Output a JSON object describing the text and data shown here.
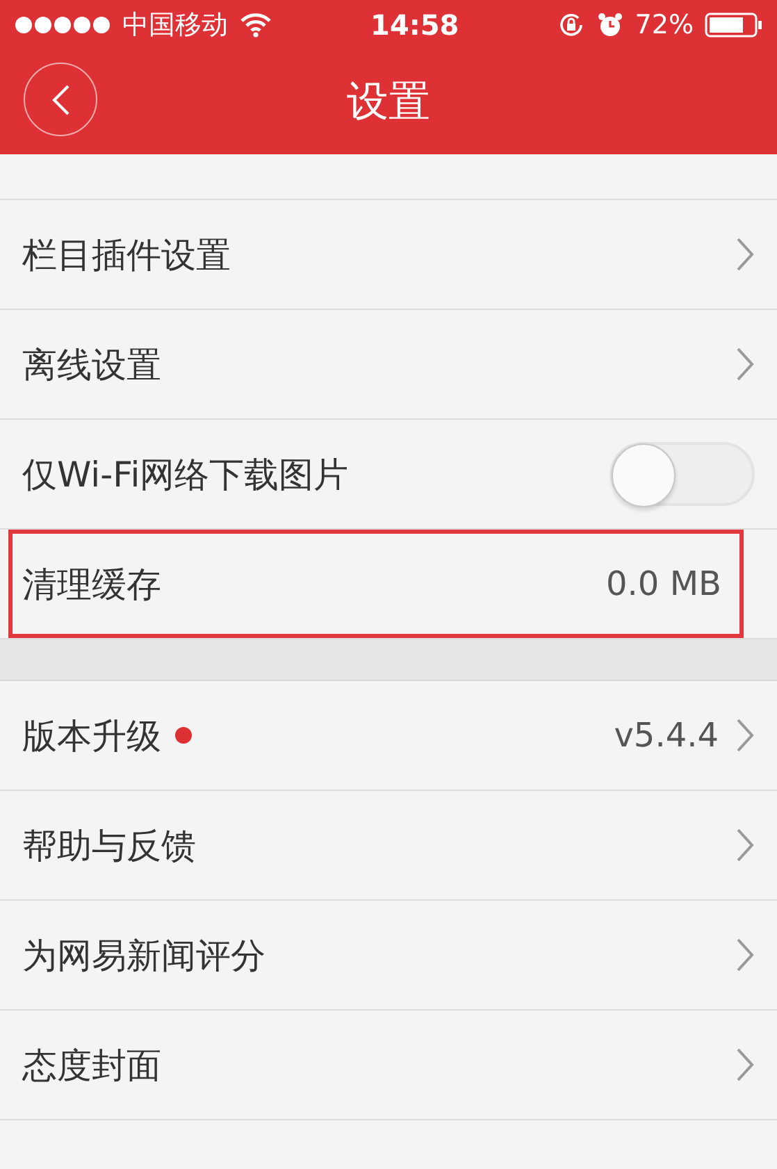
{
  "status_bar": {
    "carrier": "中国移动",
    "time": "14:58",
    "battery": "72%"
  },
  "header": {
    "title": "设置"
  },
  "groups": [
    {
      "rows": [
        {
          "kind": "link",
          "label": "栏目插件设置"
        },
        {
          "kind": "link",
          "label": "离线设置"
        },
        {
          "kind": "toggle",
          "label": "仅Wi-Fi网络下载图片",
          "on": false
        },
        {
          "kind": "value",
          "label": "清理缓存",
          "value": "0.0 MB",
          "highlighted": true
        }
      ]
    },
    {
      "rows": [
        {
          "kind": "link",
          "label": "版本升级",
          "value": "v5.4.4",
          "badge": true
        },
        {
          "kind": "link",
          "label": "帮助与反馈"
        },
        {
          "kind": "link",
          "label": "为网易新闻评分"
        },
        {
          "kind": "link",
          "label": "态度封面"
        }
      ]
    }
  ]
}
